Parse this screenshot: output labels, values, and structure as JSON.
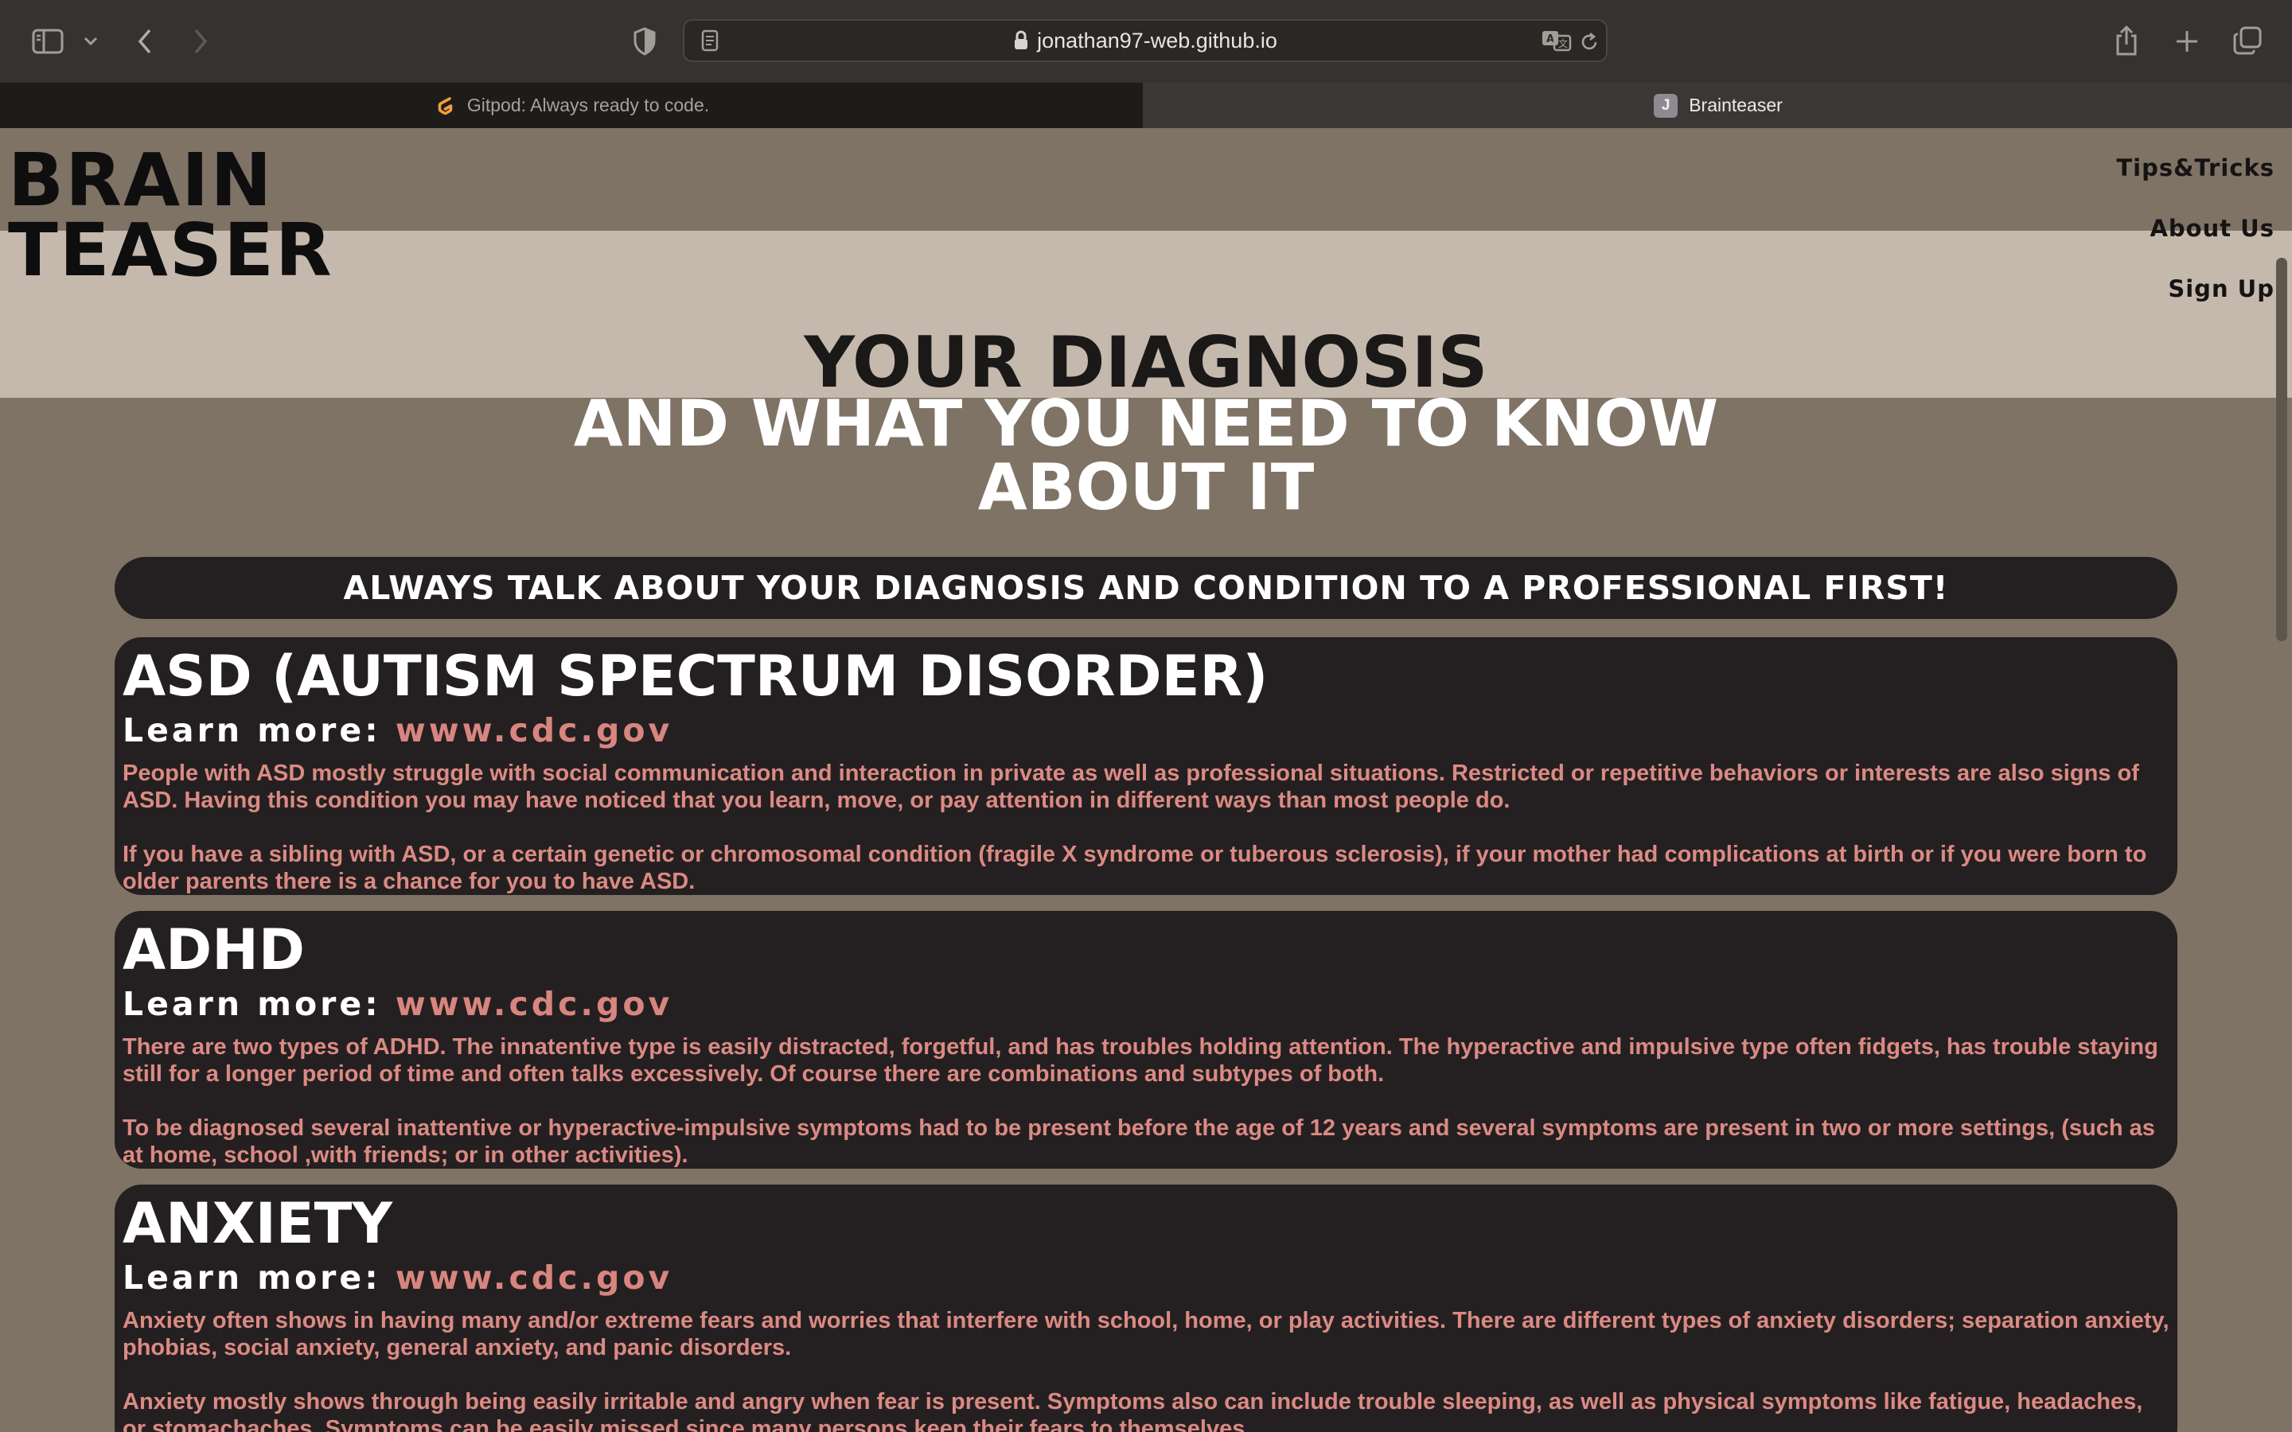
{
  "browser": {
    "url": "jonathan97-web.github.io",
    "tabs": [
      {
        "title": "Gitpod: Always ready to code.",
        "favicon": "gitpod-icon"
      },
      {
        "title": "Brainteaser",
        "favicon": "J"
      }
    ]
  },
  "site": {
    "logo_line1": "BRAIN",
    "logo_line2": "TEASER",
    "nav": [
      "Tips&Tricks",
      "About Us",
      "Sign Up"
    ],
    "hero_line1": "YOUR DIAGNOSIS",
    "hero_line2": "AND WHAT YOU NEED TO KNOW",
    "hero_line3": "ABOUT IT",
    "warning": "ALWAYS TALK ABOUT YOUR DIAGNOSIS AND CONDITION TO A PROFESSIONAL FIRST!"
  },
  "cards": [
    {
      "title": "ASD (AUTISM SPECTRUM DISORDER)",
      "learn_label": "Learn more: ",
      "learn_link": "www.cdc.gov",
      "p1": "People with ASD mostly struggle with social communication and interaction in private as well as professional situations. Restricted or repetitive behaviors or interests are also signs of ASD. Having this condition you may have noticed that you learn, move, or pay attention in different ways than most people do.",
      "p2": "If you have a sibling with ASD, or a certain genetic or chromosomal condition (fragile X syndrome or tuberous sclerosis), if your mother had complications at birth or if you were born to older parents there is a chance for you to have ASD."
    },
    {
      "title": "ADHD",
      "learn_label": "Learn more: ",
      "learn_link": "www.cdc.gov",
      "p1": "There are two types of ADHD. The innatentive type is easily distracted, forgetful, and has troubles holding attention. The hyperactive and impulsive type often fidgets, has trouble staying still for a longer period of time and often talks excessively. Of course there are combinations and subtypes of both.",
      "p2": "To be diagnosed several inattentive or hyperactive-impulsive symptoms had to be present before the age of 12 years and several symptoms are present in two or more settings, (such as at home, school ,with friends; or in other activities)."
    },
    {
      "title": "ANXIETY",
      "learn_label": "Learn more: ",
      "learn_link": "www.cdc.gov",
      "p1": "Anxiety often shows in having many and/or extreme fears and worries that interfere with school, home, or play activities. There are different types of anxiety disorders; separation anxiety, phobias, social anxiety, general anxiety, and panic disorders.",
      "p2": "Anxiety mostly shows through being easily irritable and angry when fear is present. Symptoms also can include trouble sleeping, as well as physical symptoms like fatigue, headaches, or stomachaches. Symptoms can be easily missed since many persons keep their fears to themselves."
    }
  ],
  "colors": {
    "accent_text": "#db8a83",
    "card_bg": "#242021",
    "page_bg": "#7f7366",
    "band_bg": "#c5b9ae"
  }
}
